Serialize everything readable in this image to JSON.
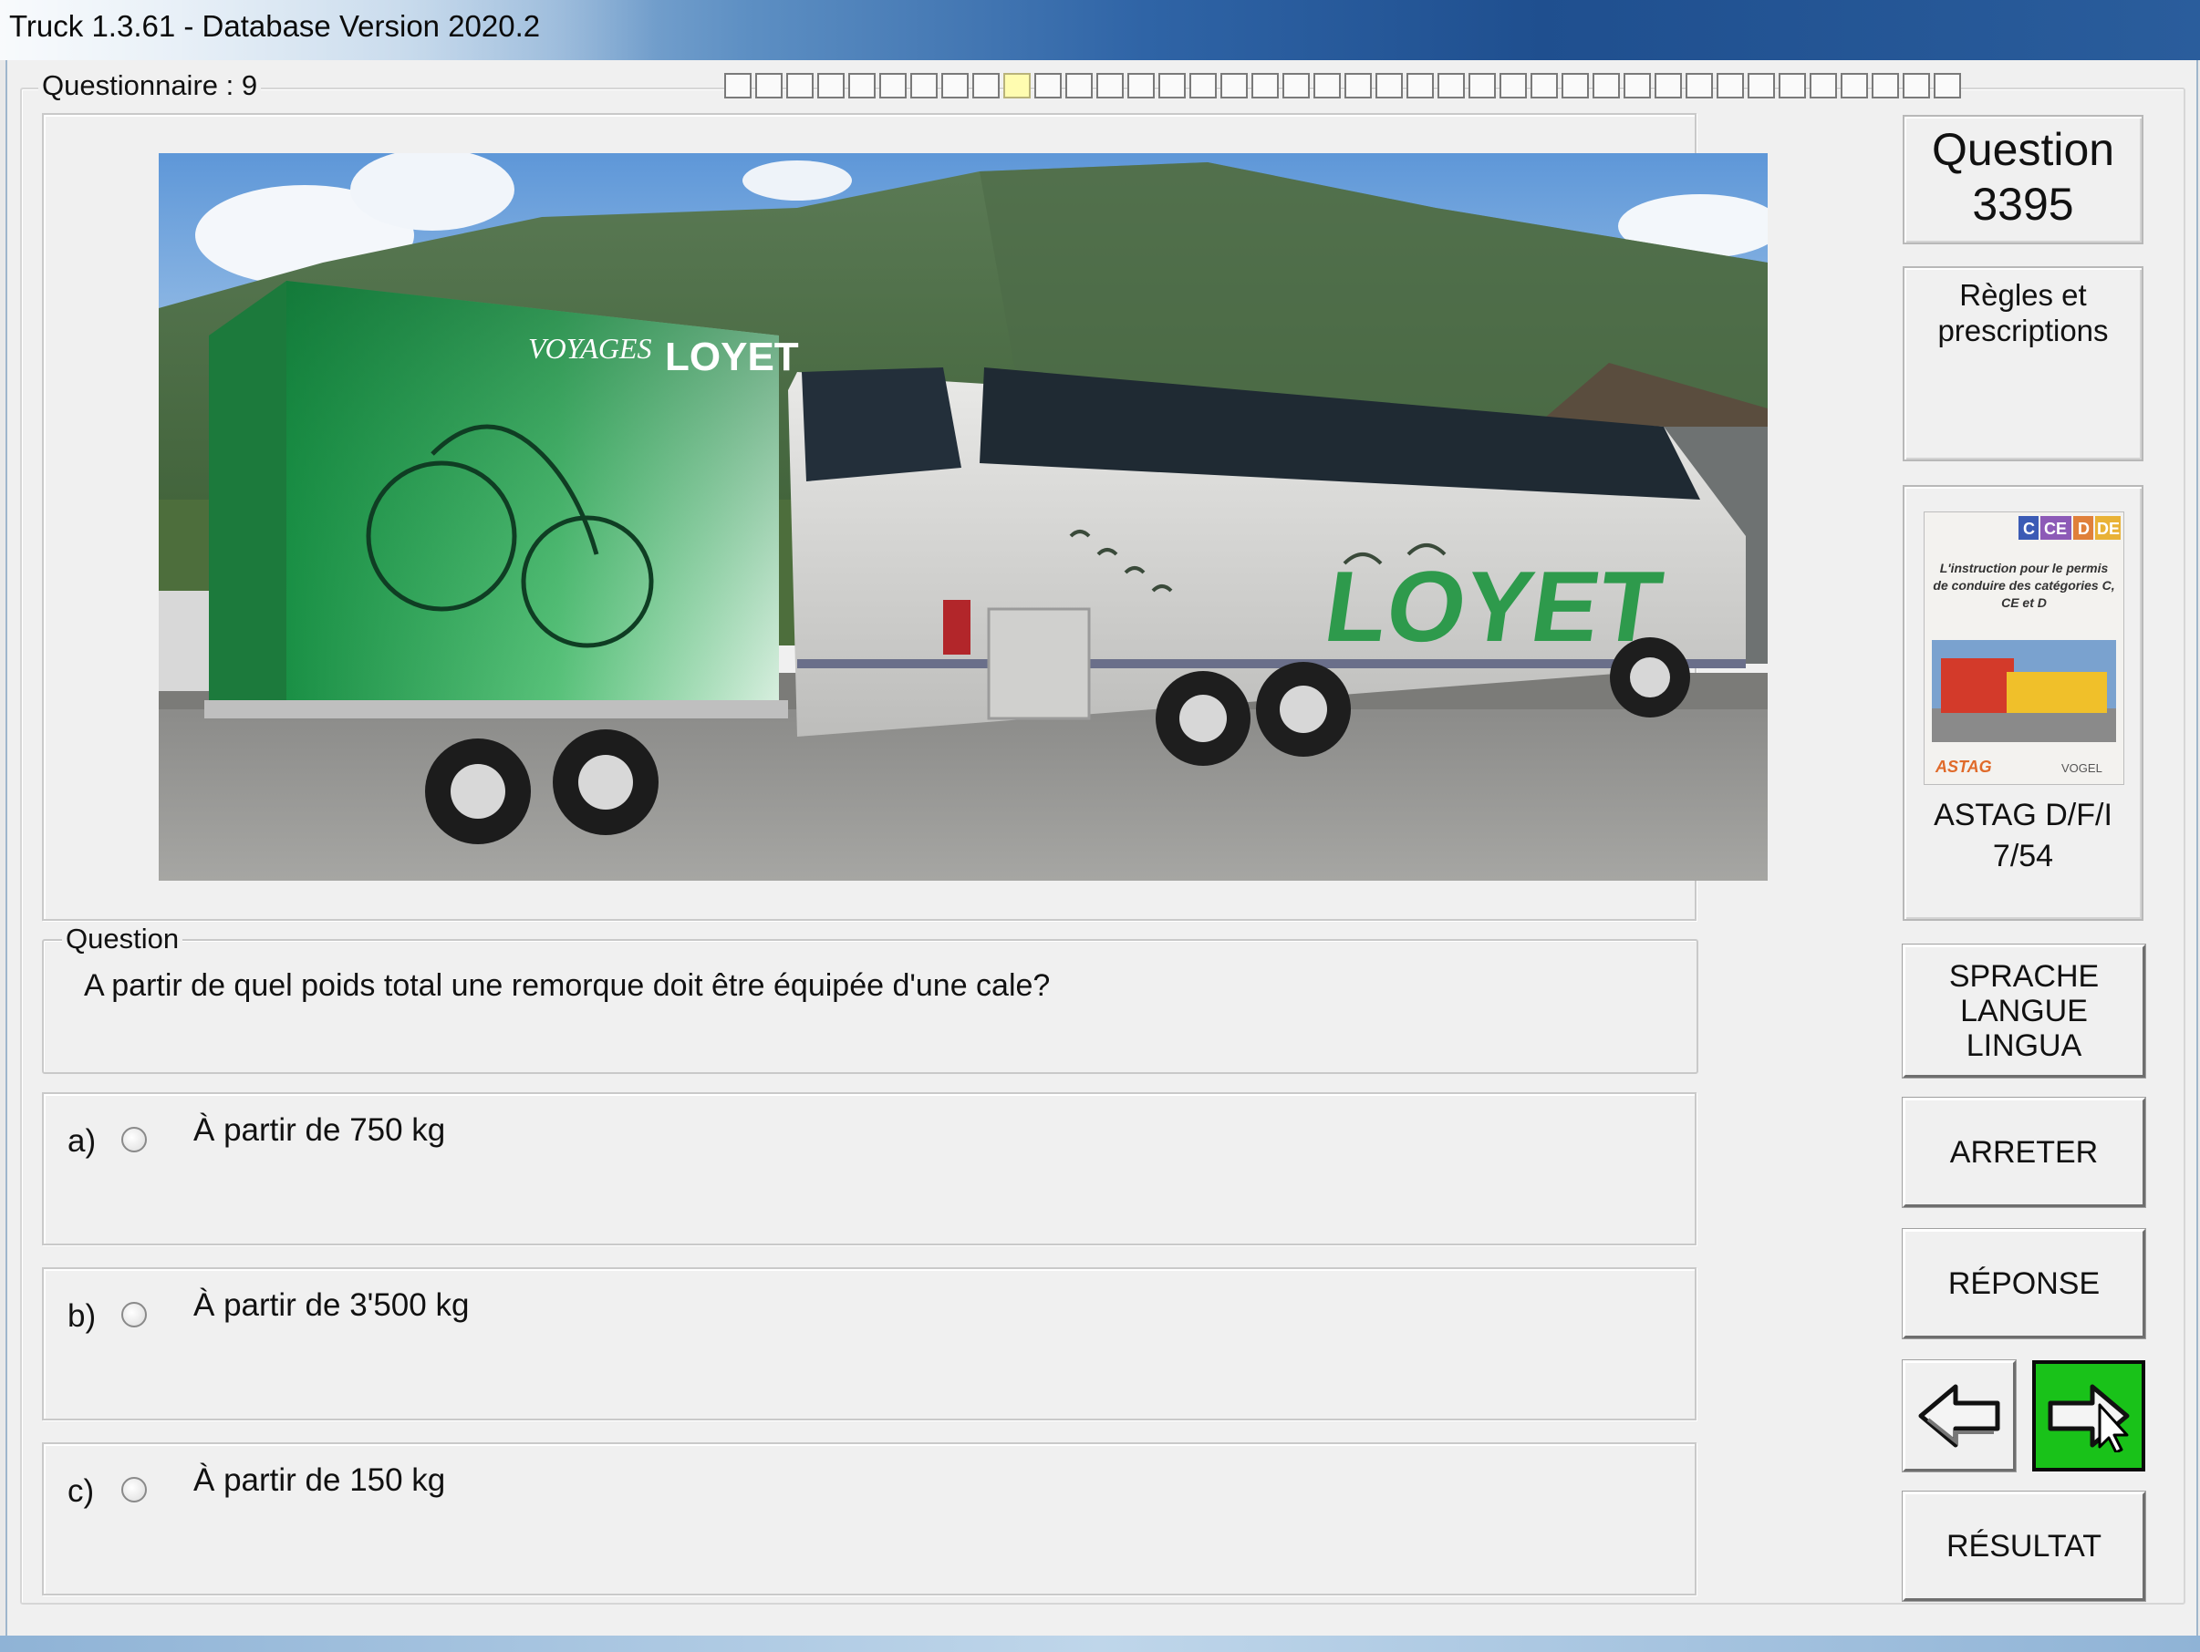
{
  "window": {
    "title": "Truck 1.3.61 - Database Version 2020.2"
  },
  "questionnaire": {
    "label": "Questionnaire : 9",
    "progress_total": 40,
    "progress_current": 10
  },
  "question_panel": {
    "legend": "Question",
    "text": "A partir de quel poids total une remorque doit être équipée d'une cale?"
  },
  "answers": [
    {
      "letter": "a)",
      "text": "À partir de 750 kg"
    },
    {
      "letter": "b)",
      "text": "À partir de 3'500 kg"
    },
    {
      "letter": "c)",
      "text": "À partir de 150 kg"
    }
  ],
  "sidebar": {
    "question_word": "Question",
    "question_number": "3395",
    "rules_line1": "Règles et",
    "rules_line2": "prescriptions",
    "book_badges": [
      "C",
      "CE",
      "D",
      "DE"
    ],
    "book_text": "L'instruction pour le permis de conduire des catégories C, CE et D",
    "book_logo_left": "ASTAG",
    "book_logo_right": "VOGEL",
    "astag_line1": "ASTAG D/F/I",
    "astag_line2": "7/54",
    "language_line1": "SPRACHE",
    "language_line2": "LANGUE",
    "language_line3": "LINGUA",
    "stop_label": "ARRETER",
    "answer_label": "RÉPONSE",
    "result_label": "RÉSULTAT"
  },
  "photo": {
    "trailer_text_small": "VOYAGES",
    "trailer_text_big": "LOYET",
    "bus_text": "LOYET"
  },
  "colors": {
    "next_button": "#19c219",
    "window_bg": "#f0f0f0",
    "progress_current": "#fffcb0"
  },
  "icons": {
    "prev": "arrow-left-icon",
    "next": "arrow-right-icon",
    "cursor": "mouse-pointer-icon"
  }
}
